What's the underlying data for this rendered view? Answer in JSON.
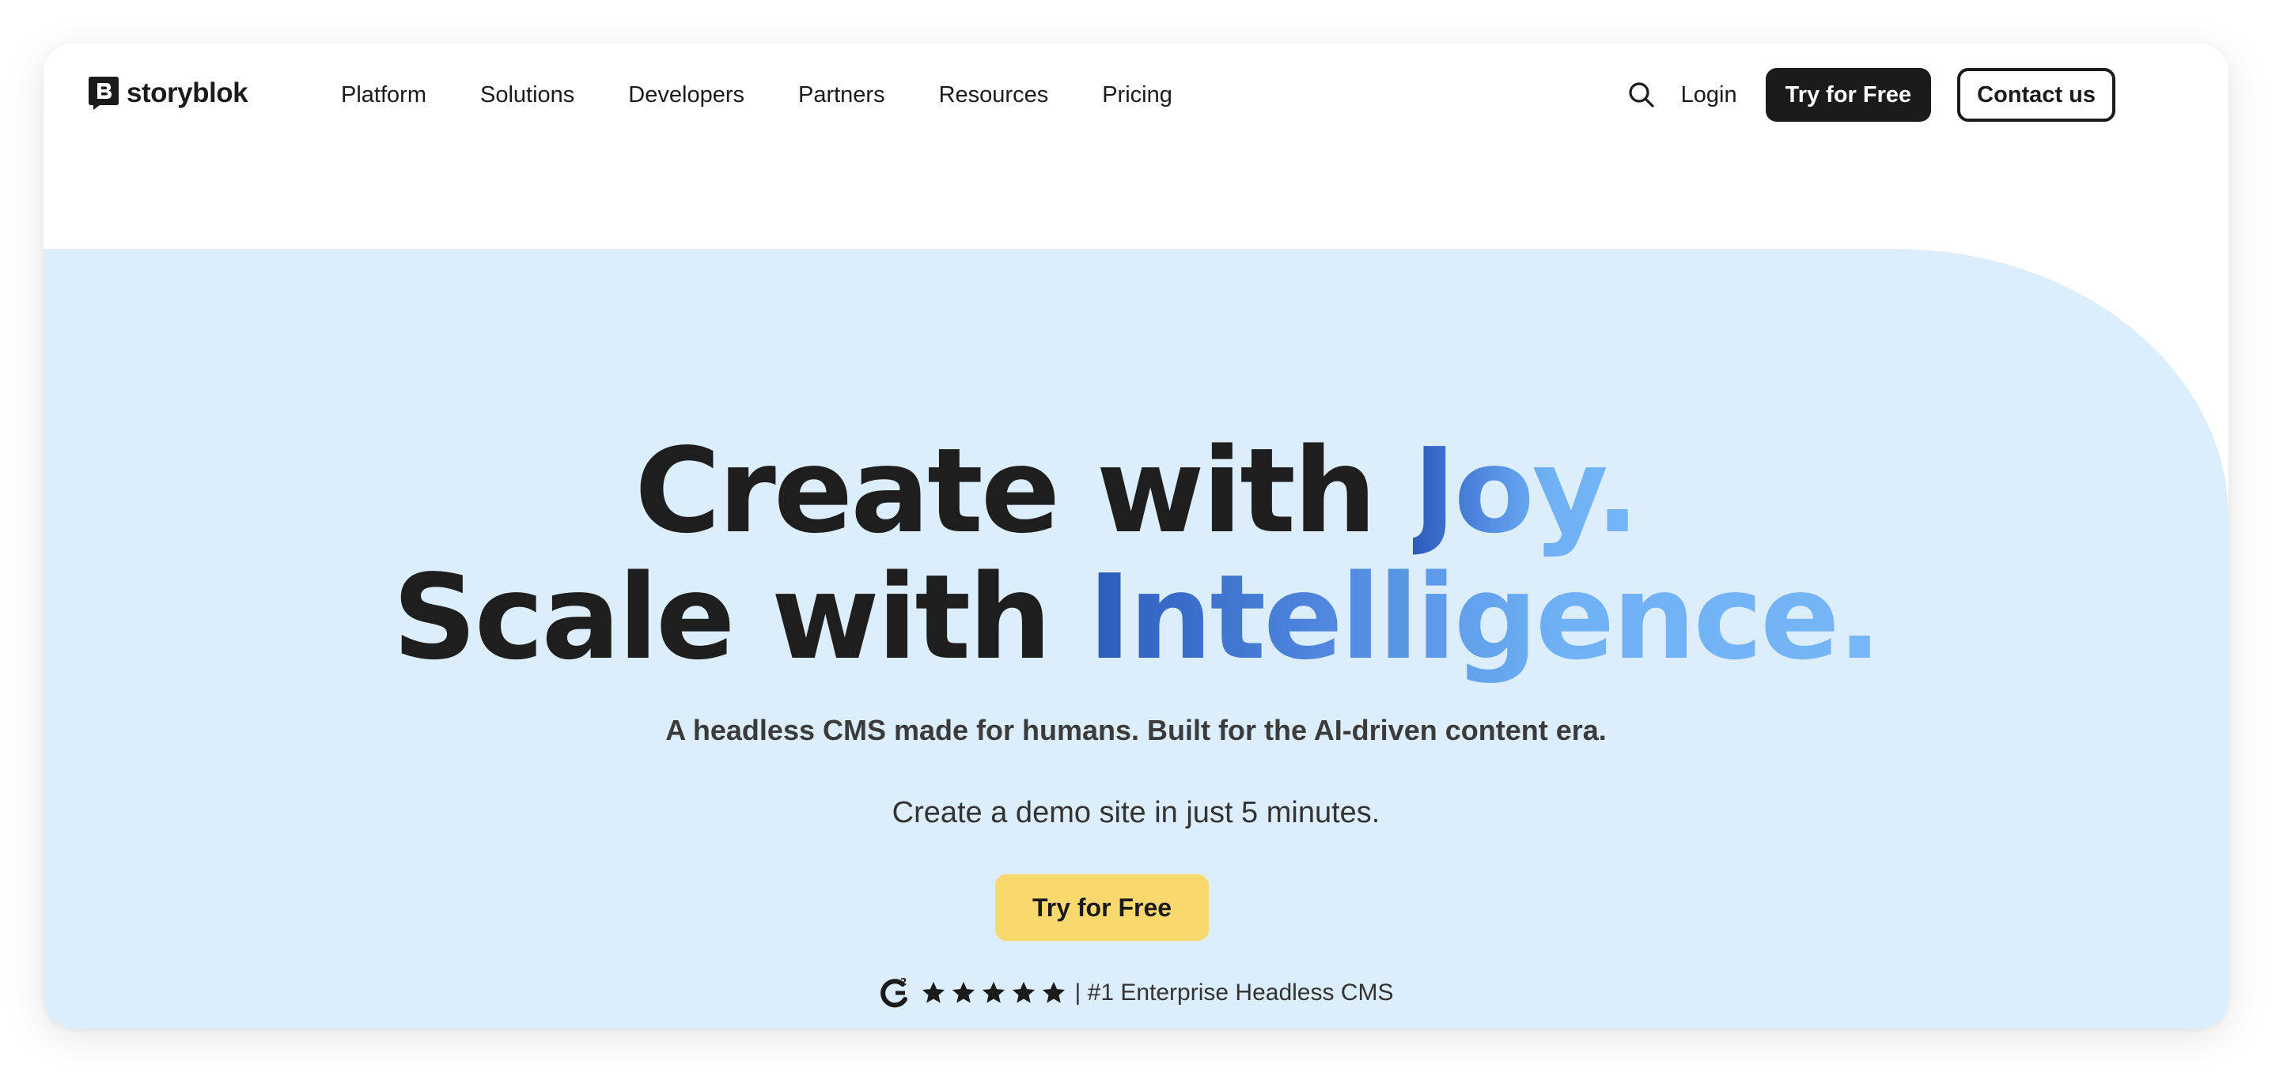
{
  "brand": {
    "name": "storyblok"
  },
  "nav": {
    "items": [
      {
        "label": "Platform"
      },
      {
        "label": "Solutions"
      },
      {
        "label": "Developers"
      },
      {
        "label": "Partners"
      },
      {
        "label": "Resources"
      },
      {
        "label": "Pricing"
      }
    ],
    "login_label": "Login",
    "try_free_label": "Try for Free",
    "contact_label": "Contact us"
  },
  "hero": {
    "line1_plain": "Create with ",
    "line1_accent": "Joy.",
    "line2_plain": "Scale with ",
    "line2_accent": "Intelligence.",
    "subheadline": "A headless CMS made for humans. Built for the AI-driven content era.",
    "demo_text": "Create a demo site in just 5 minutes.",
    "cta_label": "Try for Free",
    "rating_stars": 5,
    "rating_text": "| #1 Enterprise Headless CMS"
  },
  "colors": {
    "hero_background": "#dcedfb",
    "accent_gradient_start": "#2c5bbd",
    "accent_gradient_end": "#76b6f7",
    "cta_yellow": "#f9d96d",
    "dark": "#1b1b1b"
  },
  "icons": {
    "logo": "storyblok-logo-icon",
    "search": "search-icon",
    "g2": "g2-logo-icon",
    "star": "star-icon"
  }
}
